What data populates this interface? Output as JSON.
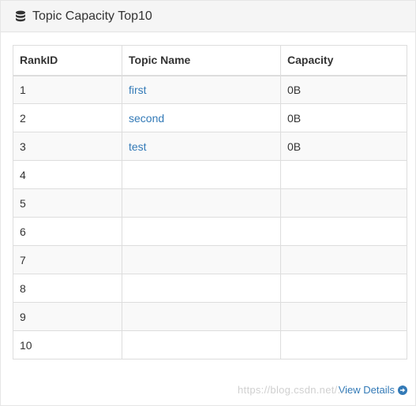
{
  "panel": {
    "icon": "database-icon",
    "title": "Topic Capacity Top10"
  },
  "table": {
    "headers": [
      "RankID",
      "Topic Name",
      "Capacity"
    ],
    "rows": [
      {
        "rank": "1",
        "topic": "first",
        "capacity": "0B"
      },
      {
        "rank": "2",
        "topic": "second",
        "capacity": "0B"
      },
      {
        "rank": "3",
        "topic": "test",
        "capacity": "0B"
      },
      {
        "rank": "4",
        "topic": "",
        "capacity": ""
      },
      {
        "rank": "5",
        "topic": "",
        "capacity": ""
      },
      {
        "rank": "6",
        "topic": "",
        "capacity": ""
      },
      {
        "rank": "7",
        "topic": "",
        "capacity": ""
      },
      {
        "rank": "8",
        "topic": "",
        "capacity": ""
      },
      {
        "rank": "9",
        "topic": "",
        "capacity": ""
      },
      {
        "rank": "10",
        "topic": "",
        "capacity": ""
      }
    ]
  },
  "footer": {
    "link_label": "View Details",
    "link_icon": "arrow-circle-right-icon",
    "watermark": "https://blog.csdn.net/..."
  },
  "colors": {
    "link": "#337ab7",
    "heading_bg": "#f5f5f5",
    "stripe_bg": "#f9f9f9",
    "border": "#dddddd"
  }
}
